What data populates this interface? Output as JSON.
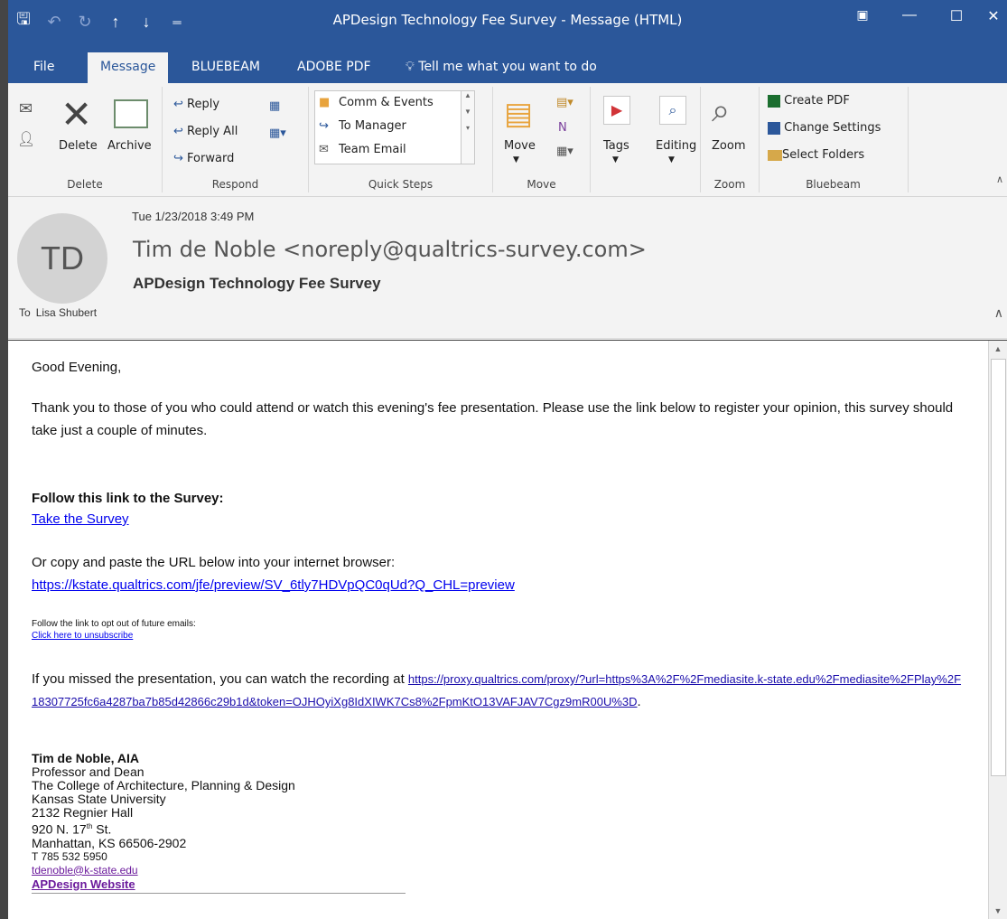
{
  "window": {
    "title": "APDesign Technology Fee Survey  -  Message (HTML)"
  },
  "tabs": {
    "file": "File",
    "message": "Message",
    "bluebeam": "BLUEBEAM",
    "adobe_pdf": "ADOBE PDF",
    "tell_me": "Tell me what you want to do"
  },
  "ribbon": {
    "delete_group": {
      "label": "Delete",
      "delete": "Delete",
      "archive": "Archive"
    },
    "respond_group": {
      "label": "Respond",
      "reply": "Reply",
      "reply_all": "Reply All",
      "forward": "Forward"
    },
    "quick_steps": {
      "label": "Quick Steps",
      "items": [
        "Comm & Events",
        "To Manager",
        "Team Email"
      ]
    },
    "move_group": {
      "label": "Move",
      "move": "Move"
    },
    "tags": "Tags",
    "editing": "Editing",
    "zoom_group": {
      "label": "Zoom",
      "zoom": "Zoom"
    },
    "bluebeam_group": {
      "label": "Bluebeam",
      "create_pdf": "Create PDF",
      "change_settings": "Change Settings",
      "select_folders": "Select Folders"
    }
  },
  "header": {
    "initials": "TD",
    "date": "Tue 1/23/2018 3:49 PM",
    "sender": "Tim de Noble <noreply@qualtrics-survey.com>",
    "subject": "APDesign Technology Fee Survey",
    "to_label": "To",
    "to_name": "Lisa Shubert"
  },
  "body": {
    "greeting": "Good Evening,",
    "para1": "Thank you to those of you who could attend or watch this evening's fee presentation. Please use the link below to register your opinion, this survey should take just a couple of minutes.",
    "follow_heading": "Follow this link to the Survey:",
    "survey_link": "Take the Survey",
    "copy_text": "Or copy and paste the URL below into your internet browser:",
    "survey_url": "https://kstate.qualtrics.com/jfe/preview/SV_6tly7HDVpQC0qUd?Q_CHL=preview",
    "optout_text": "Follow the link to opt out of future emails:",
    "unsubscribe": "Click here to unsubscribe",
    "missed_text": "If you missed the presentation, you can watch the recording at ",
    "recording_url": "https://proxy.qualtrics.com/proxy/?url=https%3A%2F%2Fmediasite.k-state.edu%2Fmediasite%2FPlay%2F18307725fc6a4287ba7b85d42866c29b1d&token=OJHOyiXg8IdXIWK7Cs8%2FpmKtO13VAFJAV7Cgz9mR00U%3D",
    "recording_end": "."
  },
  "signature": {
    "name": "Tim de Noble, AIA",
    "title": "Professor and Dean",
    "college": "The College of Architecture, Planning & Design",
    "university": "Kansas State University",
    "office": "2132 Regnier Hall",
    "street_num": "920 N. 17",
    "street_sup": "th",
    "street_end": " St.",
    "city": "Manhattan, KS 66506-2902",
    "phone": "T 785 532 5950",
    "email": "tdenoble@k-state.edu",
    "website": "APDesign Website"
  },
  "colors": {
    "accent": "#2b579a",
    "link": "#1a0dab"
  }
}
